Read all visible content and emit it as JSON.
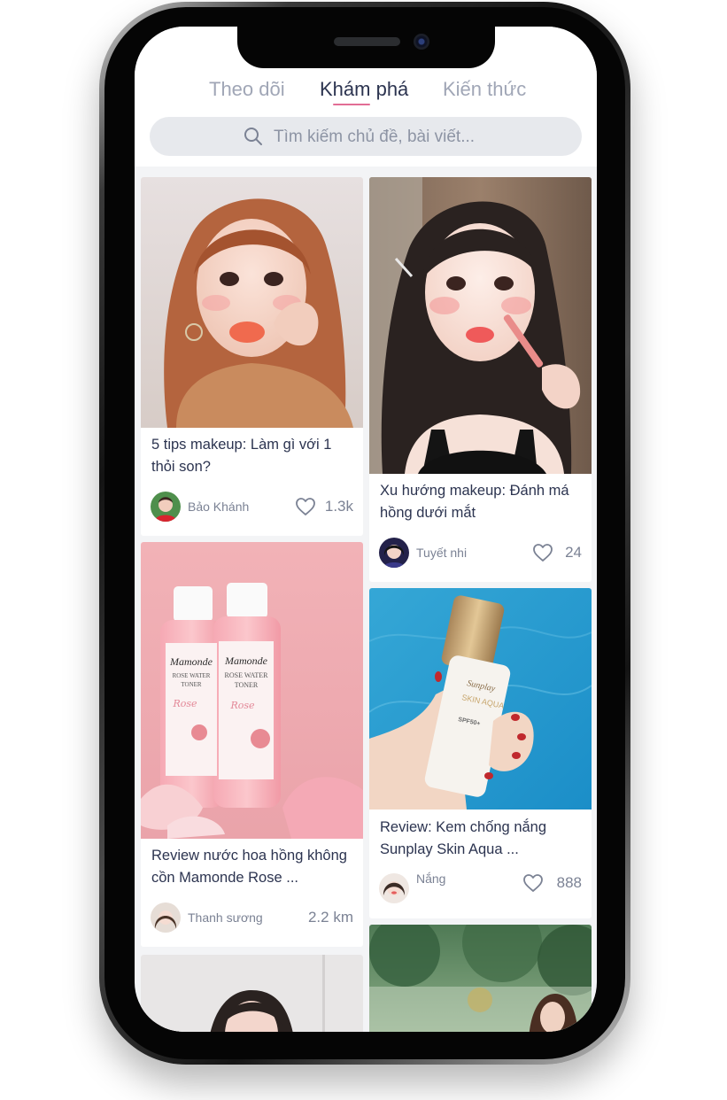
{
  "tabs": [
    {
      "label": "Theo dõi",
      "active": false
    },
    {
      "label": "Khám phá",
      "active": true
    },
    {
      "label": "Kiến thức",
      "active": false
    }
  ],
  "search": {
    "placeholder": "Tìm kiếm chủ đề, bài viết..."
  },
  "posts": [
    {
      "title_lines": [
        "5 tips makeup: Làm gì với 1",
        "thỏi son?"
      ],
      "author": "Bảo Khánh",
      "stat": "1.3k",
      "stat_icon": "heart-icon"
    },
    {
      "title_lines": [
        "Xu hướng makeup: Đánh má",
        "hồng dưới mắt"
      ],
      "author": "Tuyết nhi",
      "stat": "24",
      "stat_icon": "heart-icon"
    },
    {
      "title_lines": [
        "Review nước hoa hồng không",
        "cồn Mamonde Rose ..."
      ],
      "author": "Thanh sương",
      "stat": "2.2 km",
      "stat_icon": ""
    },
    {
      "title_lines": [
        "Review: Kem chống nắng",
        "Sunplay Skin Aqua ..."
      ],
      "author": "Nắng",
      "stat": "888",
      "stat_icon": "heart-icon"
    }
  ],
  "image_text": {
    "toner_brand": "Mamonde",
    "toner_line1": "ROSE WATER",
    "toner_line2": "TONER",
    "toner_script": "Rose",
    "sunscreen_brand": "Sunplay",
    "sunscreen_line1": "SKIN AQUA",
    "sunscreen_spf": "SPF50+"
  },
  "colors": {
    "accent_underline": "#e26d95",
    "active_tab": "#2c3450",
    "inactive_tab": "#a0a6b6",
    "card_text": "#2c3450",
    "muted_text": "#7b8294",
    "feed_background": "#f3f4f6"
  }
}
